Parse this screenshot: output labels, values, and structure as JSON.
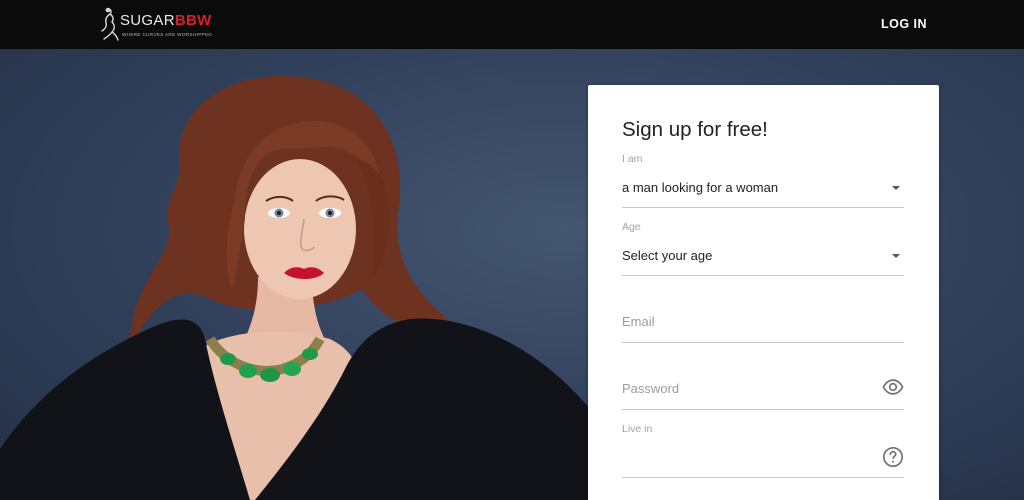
{
  "header": {
    "logo_sugar": "SUGAR",
    "logo_bbw": "BBW",
    "logo_tagline": "WHERE CURVES ARE WORSHIPPED",
    "login_label": "LOG IN"
  },
  "signup": {
    "title": "Sign up for free!",
    "i_am_label": "I am",
    "i_am_value": "a man looking for a woman",
    "age_label": "Age",
    "age_value": "Select your age",
    "email_placeholder": "Email",
    "password_placeholder": "Password",
    "live_in_label": "Live in"
  },
  "icons": {
    "logo": "silhouette-logo-icon",
    "i_am_dropdown": "caret-down-icon",
    "age_dropdown": "caret-down-icon",
    "password_toggle": "eye-icon",
    "live_in_help": "question-circle-icon"
  },
  "colors": {
    "topbar": "#0b0b0c",
    "brand_red": "#d6202d",
    "hero_background": "#34435e",
    "card": "#ffffff"
  }
}
